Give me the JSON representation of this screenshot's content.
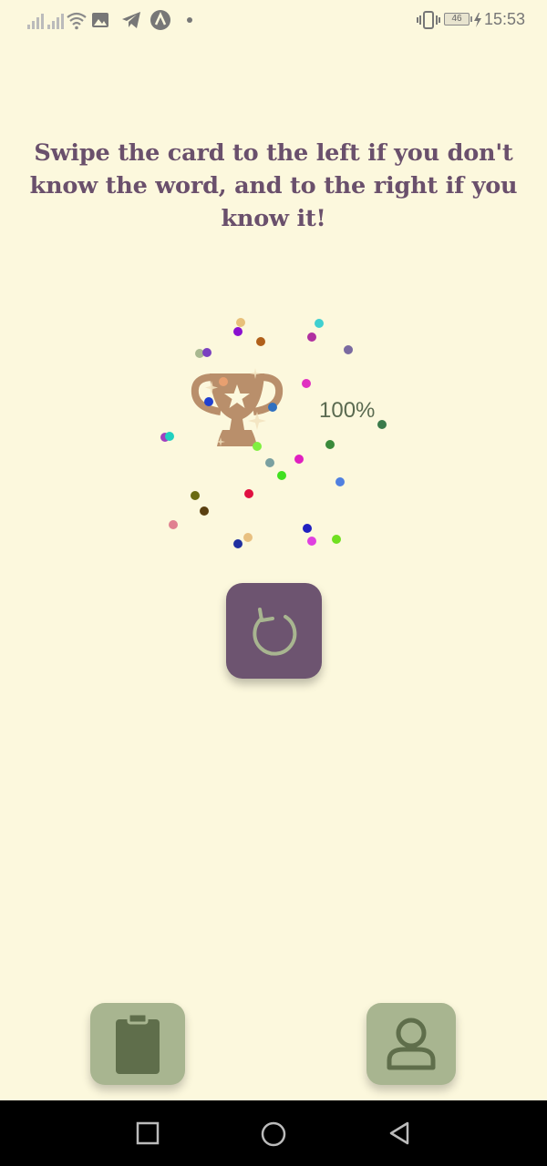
{
  "status_bar": {
    "time": "15:53",
    "battery_level": "46",
    "icons": [
      "signal-icon",
      "signal-icon",
      "wifi-icon",
      "image-icon",
      "telegram-icon",
      "app-icon",
      "notification-dot-icon",
      "vibrate-icon",
      "battery-icon",
      "charging-icon"
    ]
  },
  "instruction": {
    "text": "Swipe the card to the left if you don't know the word, and to the right if you know it!"
  },
  "result": {
    "percent": "100%",
    "icon": "trophy-icon"
  },
  "colors": {
    "background": "#fcf8dd",
    "accent_purple": "#6d5470",
    "nav_green": "#a8b590",
    "icon_dark_green": "#5f6e4b",
    "trophy": "#b98f6b",
    "text_purple": "#6a506c"
  },
  "actions": {
    "restart_icon": "restart-icon"
  },
  "bottom_nav": {
    "items": [
      {
        "icon": "clipboard-icon"
      },
      {
        "icon": "profile-icon"
      }
    ]
  },
  "system_nav": {
    "items": [
      "recent-apps-icon",
      "home-icon",
      "back-icon"
    ]
  }
}
